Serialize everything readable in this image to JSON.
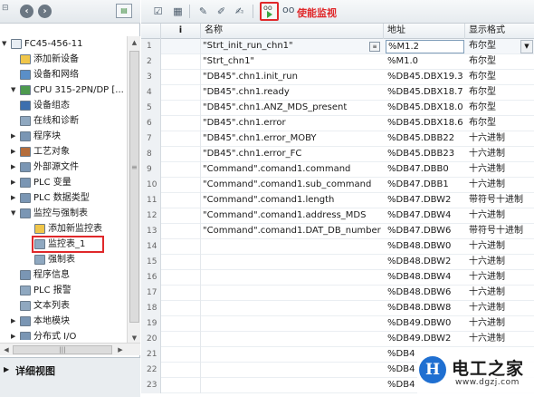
{
  "tree": {
    "items": [
      {
        "label": "FC45-456-11",
        "level": 0,
        "arrow": "▼",
        "icon": "project-icon",
        "color": "#e8eef4"
      },
      {
        "label": "添加新设备",
        "level": 1,
        "arrow": "",
        "icon": "add-device-icon",
        "color": "#f0c64a"
      },
      {
        "label": "设备和网络",
        "level": 1,
        "arrow": "",
        "icon": "network-icon",
        "color": "#5a8fc8"
      },
      {
        "label": "CPU 315-2PN/DP [...",
        "level": 1,
        "arrow": "▼",
        "icon": "cpu-icon",
        "color": "#4d9a4f"
      },
      {
        "label": "设备组态",
        "level": 2,
        "arrow": "",
        "icon": "device-config-icon",
        "color": "#3c6fae"
      },
      {
        "label": "在线和诊断",
        "level": 2,
        "arrow": "",
        "icon": "diagnostics-icon",
        "color": "#8fa8c0"
      },
      {
        "label": "程序块",
        "level": 2,
        "arrow": "▶",
        "icon": "program-blocks-icon",
        "color": "#7a96b4"
      },
      {
        "label": "工艺对象",
        "level": 2,
        "arrow": "▶",
        "icon": "technology-objects-icon",
        "color": "#b46d3c"
      },
      {
        "label": "外部源文件",
        "level": 2,
        "arrow": "▶",
        "icon": "external-sources-icon",
        "color": "#7a96b4"
      },
      {
        "label": "PLC 变量",
        "level": 2,
        "arrow": "▶",
        "icon": "plc-tags-icon",
        "color": "#7a96b4"
      },
      {
        "label": "PLC 数据类型",
        "level": 2,
        "arrow": "▶",
        "icon": "plc-datatypes-icon",
        "color": "#7a96b4"
      },
      {
        "label": "监控与强制表",
        "level": 2,
        "arrow": "▼",
        "icon": "watch-force-folder-icon",
        "color": "#7a96b4"
      },
      {
        "label": "添加新监控表",
        "level": 3,
        "arrow": "",
        "icon": "add-watch-table-icon",
        "color": "#f0c64a"
      },
      {
        "label": "监控表_1",
        "level": 3,
        "arrow": "",
        "icon": "watch-table-icon",
        "color": "#8fa8c0"
      },
      {
        "label": "强制表",
        "level": 3,
        "arrow": "",
        "icon": "force-table-icon",
        "color": "#8fa8c0"
      },
      {
        "label": "程序信息",
        "level": 2,
        "arrow": "",
        "icon": "program-info-icon",
        "color": "#7a96b4"
      },
      {
        "label": "PLC 报警",
        "level": 2,
        "arrow": "",
        "icon": "plc-alarms-icon",
        "color": "#8fa8c0"
      },
      {
        "label": "文本列表",
        "level": 2,
        "arrow": "",
        "icon": "text-lists-icon",
        "color": "#8fa8c0"
      },
      {
        "label": "本地模块",
        "level": 2,
        "arrow": "▶",
        "icon": "local-modules-icon",
        "color": "#7a96b4"
      },
      {
        "label": "分布式 I/O",
        "level": 2,
        "arrow": "▶",
        "icon": "distributed-io-icon",
        "color": "#7a96b4"
      }
    ],
    "selected_index": 13
  },
  "details": {
    "title": "详细视图"
  },
  "toolbar": {
    "enable_monitor_label": "使能监视"
  },
  "table": {
    "headers": {
      "num": "",
      "i": "i",
      "name": "名称",
      "address": "地址",
      "format": "显示格式"
    },
    "rows": [
      {
        "num": "1",
        "name": "\"Strt_init_run_chn1\"",
        "address": "%M1.2",
        "format": "布尔型"
      },
      {
        "num": "2",
        "name": "\"Strt_chn1\"",
        "address": "%M1.0",
        "format": "布尔型"
      },
      {
        "num": "3",
        "name": "\"DB45\".chn1.init_run",
        "address": "%DB45.DBX19.3",
        "format": "布尔型"
      },
      {
        "num": "4",
        "name": "\"DB45\".chn1.ready",
        "address": "%DB45.DBX18.7",
        "format": "布尔型"
      },
      {
        "num": "5",
        "name": "\"DB45\".chn1.ANZ_MDS_present",
        "address": "%DB45.DBX18.0",
        "format": "布尔型"
      },
      {
        "num": "6",
        "name": "\"DB45\".chn1.error",
        "address": "%DB45.DBX18.6",
        "format": "布尔型"
      },
      {
        "num": "7",
        "name": "\"DB45\".chn1.error_MOBY",
        "address": "%DB45.DBB22",
        "format": "十六进制"
      },
      {
        "num": "8",
        "name": "\"DB45\".chn1.error_FC",
        "address": "%DB45.DBB23",
        "format": "十六进制"
      },
      {
        "num": "9",
        "name": "\"Command\".comand1.command",
        "address": "%DB47.DBB0",
        "format": "十六进制"
      },
      {
        "num": "10",
        "name": "\"Command\".comand1.sub_command",
        "address": "%DB47.DBB1",
        "format": "十六进制"
      },
      {
        "num": "11",
        "name": "\"Command\".comand1.length",
        "address": "%DB47.DBW2",
        "format": "带符号十进制"
      },
      {
        "num": "12",
        "name": "\"Command\".comand1.address_MDS",
        "address": "%DB47.DBW4",
        "format": "十六进制"
      },
      {
        "num": "13",
        "name": "\"Command\".comand1.DAT_DB_number",
        "address": "%DB47.DBW6",
        "format": "带符号十进制"
      },
      {
        "num": "14",
        "name": "",
        "address": "%DB48.DBW0",
        "format": "十六进制"
      },
      {
        "num": "15",
        "name": "",
        "address": "%DB48.DBW2",
        "format": "十六进制"
      },
      {
        "num": "16",
        "name": "",
        "address": "%DB48.DBW4",
        "format": "十六进制"
      },
      {
        "num": "17",
        "name": "",
        "address": "%DB48.DBW6",
        "format": "十六进制"
      },
      {
        "num": "18",
        "name": "",
        "address": "%DB48.DBW8",
        "format": "十六进制"
      },
      {
        "num": "19",
        "name": "",
        "address": "%DB49.DBW0",
        "format": "十六进制"
      },
      {
        "num": "20",
        "name": "",
        "address": "%DB49.DBW2",
        "format": "十六进制"
      },
      {
        "num": "21",
        "name": "",
        "address": "%DB4",
        "format": ""
      },
      {
        "num": "22",
        "name": "",
        "address": "%DB4",
        "format": ""
      },
      {
        "num": "23",
        "name": "",
        "address": "%DB4",
        "format": ""
      }
    ]
  },
  "logo": {
    "brand": "电工之家",
    "url": "www.dgzj.com",
    "badge": "H"
  }
}
